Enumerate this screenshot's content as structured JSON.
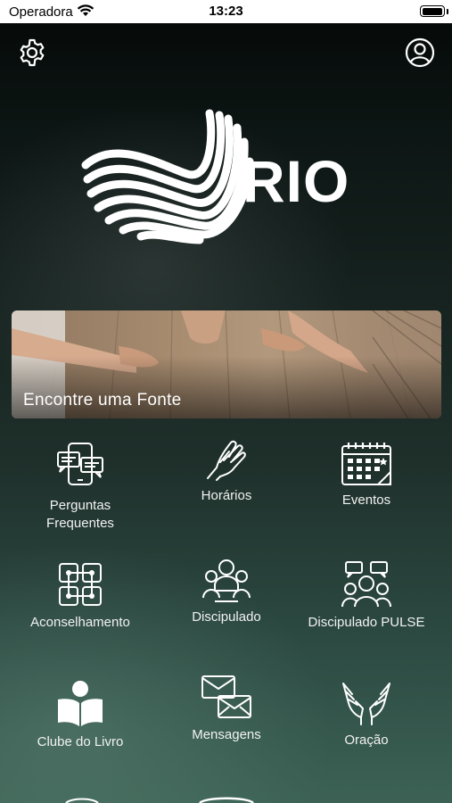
{
  "status_bar": {
    "carrier": "Operadora",
    "time": "13:23",
    "battery_level": 1.0
  },
  "header": {
    "settings_icon": "gear-icon",
    "profile_icon": "user-circle-icon"
  },
  "logo": {
    "text": "RIO"
  },
  "banner": {
    "title": "Encontre uma Fonte"
  },
  "menu": [
    {
      "label": "Perguntas\nFrequentes",
      "icon": "faq-phone-chat-icon"
    },
    {
      "label": "Horários",
      "icon": "praying-hands-icon"
    },
    {
      "label": "Eventos",
      "icon": "calendar-icon"
    },
    {
      "label": "Aconselhamento",
      "icon": "linked-hands-icon"
    },
    {
      "label": "Discipulado",
      "icon": "group-people-icon"
    },
    {
      "label": "Discipulado PULSE",
      "icon": "people-chat-icon"
    },
    {
      "label": "Clube do Livro",
      "icon": "reader-book-icon"
    },
    {
      "label": "Mensagens",
      "icon": "envelopes-icon"
    },
    {
      "label": "Oração",
      "icon": "raised-hands-icon"
    }
  ],
  "colors": {
    "background_top": "#050807",
    "background_bottom": "#3c6255",
    "text": "#ffffff"
  }
}
